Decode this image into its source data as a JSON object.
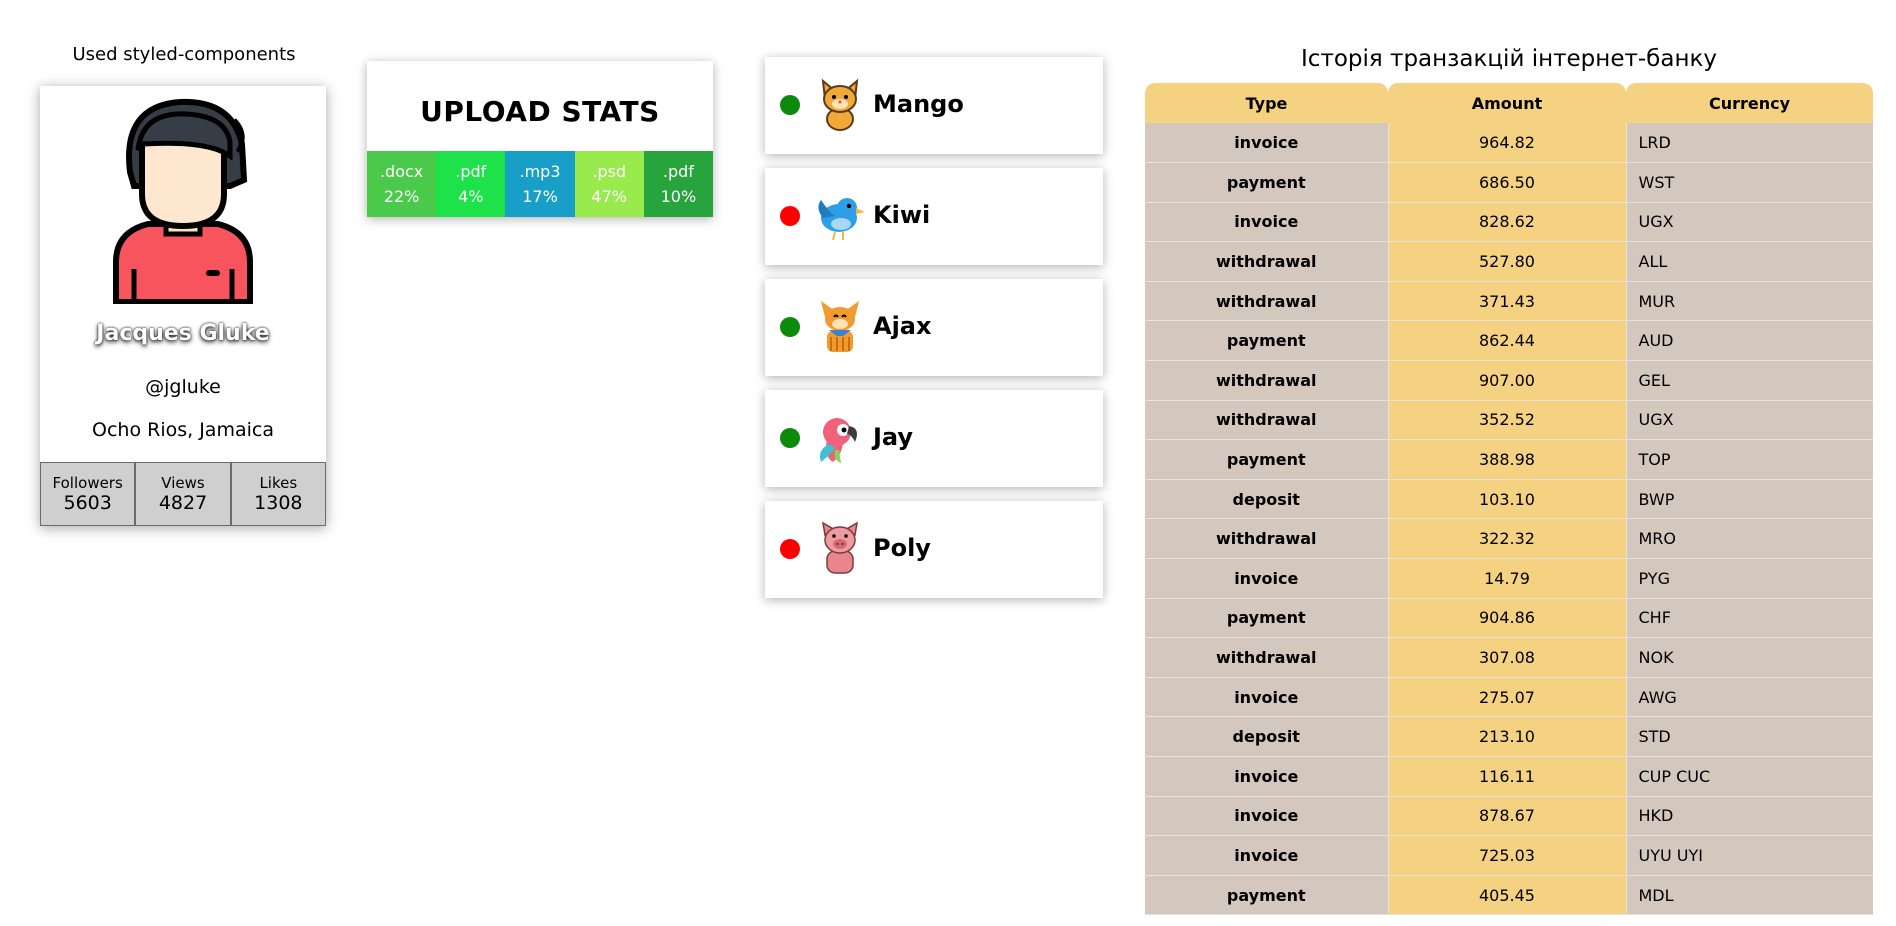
{
  "profile": {
    "caption": "Used styled-components",
    "name": "Jacques Gluke",
    "handle": "@jgluke",
    "location": "Ocho Rios, Jamaica",
    "avatar_icon": "user-avatar-icon",
    "stats": [
      {
        "label": "Followers",
        "value": "5603"
      },
      {
        "label": "Views",
        "value": "4827"
      },
      {
        "label": "Likes",
        "value": "1308"
      }
    ]
  },
  "upload": {
    "title": "UPLOAD STATS",
    "items": [
      {
        "label": ".docx",
        "percent": "22%",
        "color": "#4bc94b"
      },
      {
        "label": ".pdf",
        "percent": "4%",
        "color": "#1ee24a"
      },
      {
        "label": ".mp3",
        "percent": "17%",
        "color": "#179fc8"
      },
      {
        "label": ".psd",
        "percent": "47%",
        "color": "#99ea4c"
      },
      {
        "label": ".pdf",
        "percent": "10%",
        "color": "#27a43c"
      }
    ]
  },
  "friends": [
    {
      "name": "Mango",
      "online": true,
      "status_color": "#0b8a0b",
      "icon": "cat-icon"
    },
    {
      "name": "Kiwi",
      "online": false,
      "status_color": "#ff0000",
      "icon": "bird-icon"
    },
    {
      "name": "Ajax",
      "online": true,
      "status_color": "#0b8a0b",
      "icon": "dog-icon"
    },
    {
      "name": "Jay",
      "online": true,
      "status_color": "#0b8a0b",
      "icon": "parrot-icon"
    },
    {
      "name": "Poly",
      "online": false,
      "status_color": "#ff0000",
      "icon": "pig-icon"
    }
  ],
  "transactions": {
    "title": "Історія транзакцій інтернет-банку",
    "headers": [
      "Type",
      "Amount",
      "Currency"
    ],
    "rows": [
      [
        "invoice",
        "964.82",
        "LRD"
      ],
      [
        "payment",
        "686.50",
        "WST"
      ],
      [
        "invoice",
        "828.62",
        "UGX"
      ],
      [
        "withdrawal",
        "527.80",
        "ALL"
      ],
      [
        "withdrawal",
        "371.43",
        "MUR"
      ],
      [
        "payment",
        "862.44",
        "AUD"
      ],
      [
        "withdrawal",
        "907.00",
        "GEL"
      ],
      [
        "withdrawal",
        "352.52",
        "UGX"
      ],
      [
        "payment",
        "388.98",
        "TOP"
      ],
      [
        "deposit",
        "103.10",
        "BWP"
      ],
      [
        "withdrawal",
        "322.32",
        "MRO"
      ],
      [
        "invoice",
        "14.79",
        "PYG"
      ],
      [
        "payment",
        "904.86",
        "CHF"
      ],
      [
        "withdrawal",
        "307.08",
        "NOK"
      ],
      [
        "invoice",
        "275.07",
        "AWG"
      ],
      [
        "deposit",
        "213.10",
        "STD"
      ],
      [
        "invoice",
        "116.11",
        "CUP CUC"
      ],
      [
        "invoice",
        "878.67",
        "HKD"
      ],
      [
        "invoice",
        "725.03",
        "UYU UYI"
      ],
      [
        "payment",
        "405.45",
        "MDL"
      ]
    ]
  }
}
